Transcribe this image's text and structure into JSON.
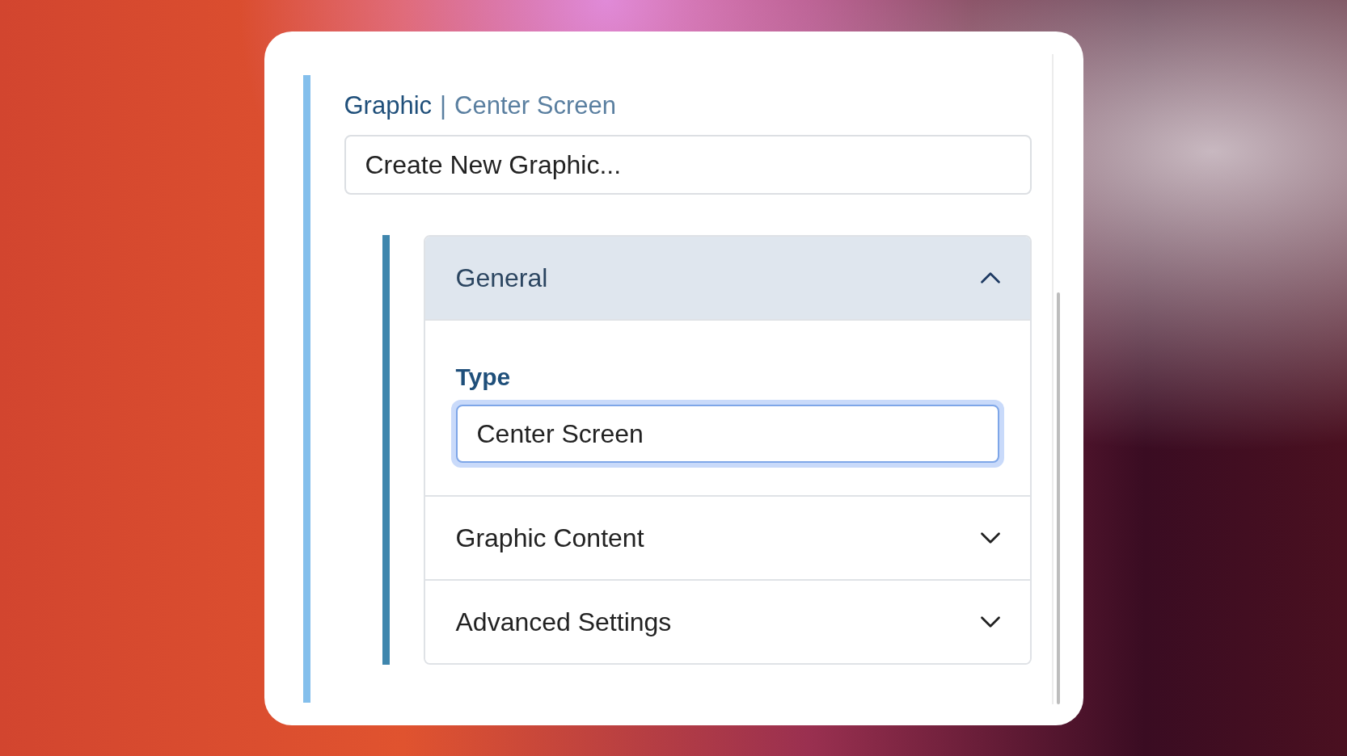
{
  "header": {
    "title": "Graphic",
    "separator": "|",
    "subtitle": "Center Screen"
  },
  "create_select": {
    "value": "Create New Graphic..."
  },
  "sections": [
    {
      "title": "General",
      "expanded": true,
      "fields": [
        {
          "label": "Type",
          "value": "Center Screen",
          "focused": true
        }
      ]
    },
    {
      "title": "Graphic Content",
      "expanded": false
    },
    {
      "title": "Advanced Settings",
      "expanded": false
    }
  ]
}
